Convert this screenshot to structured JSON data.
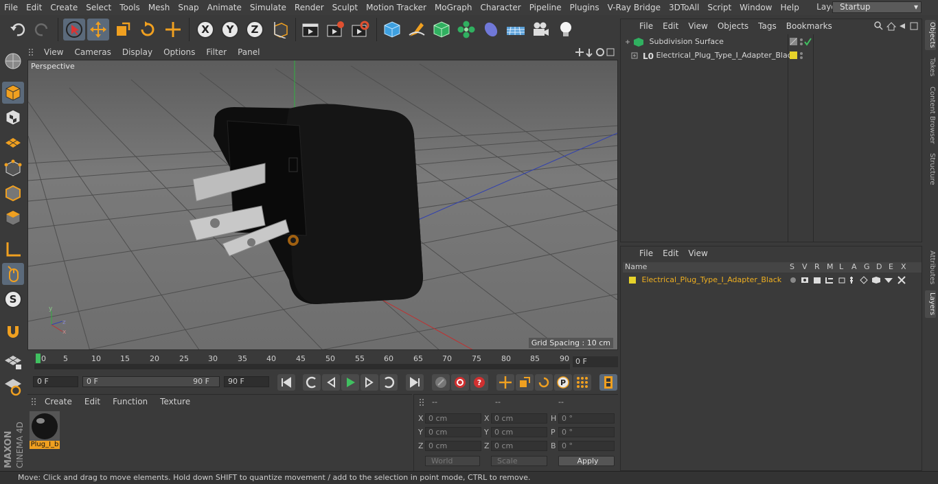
{
  "menubar": {
    "items": [
      "File",
      "Edit",
      "Create",
      "Select",
      "Tools",
      "Mesh",
      "Snap",
      "Animate",
      "Simulate",
      "Render",
      "Sculpt",
      "Motion Tracker",
      "MoGraph",
      "Character",
      "Pipeline",
      "Plugins",
      "V-Ray Bridge",
      "3DToAll",
      "Script",
      "Window",
      "Help"
    ],
    "layout_label": "Layout:",
    "layout_value": "Startup"
  },
  "toolbar": {
    "icons": [
      "undo-icon",
      "redo-icon",
      "select-arrow-icon",
      "move-icon",
      "scale-icon",
      "rotate-icon",
      "transform-icon",
      "x-axis-icon",
      "y-axis-icon",
      "z-axis-icon",
      "world-coord-icon",
      "render-view-icon",
      "render-picture-viewer-icon",
      "render-settings-icon",
      "cube-icon",
      "pen-icon",
      "subdivision-icon",
      "cloner-icon",
      "deformer-icon",
      "floor-icon",
      "camera-icon",
      "light-icon"
    ],
    "axis_x": "X",
    "axis_y": "Y",
    "axis_z": "Z"
  },
  "viewport": {
    "menu": [
      "View",
      "Cameras",
      "Display",
      "Options",
      "Filter",
      "Panel"
    ],
    "label": "Perspective",
    "grid_spacing": "Grid Spacing : 10 cm"
  },
  "timeline": {
    "ticks": [
      "0",
      "5",
      "10",
      "15",
      "20",
      "25",
      "30",
      "35",
      "40",
      "45",
      "50",
      "55",
      "60",
      "65",
      "70",
      "75",
      "80",
      "85",
      "90"
    ],
    "current_frame": "0 F"
  },
  "transport": {
    "start_field": "0 F",
    "range_start": "0 F",
    "range_end": "90 F",
    "end_field": "90 F"
  },
  "materials": {
    "menu": [
      "Create",
      "Edit",
      "Function",
      "Texture"
    ],
    "material_name": "Plug_I_b"
  },
  "coords": {
    "header": [
      "--",
      "--",
      "--"
    ],
    "rows": [
      {
        "a": "X",
        "av": "0 cm",
        "b": "X",
        "bv": "0 cm",
        "c": "H",
        "cv": "0 °"
      },
      {
        "a": "Y",
        "av": "0 cm",
        "b": "Y",
        "bv": "0 cm",
        "c": "P",
        "cv": "0 °"
      },
      {
        "a": "Z",
        "av": "0 cm",
        "b": "Z",
        "bv": "0 cm",
        "c": "B",
        "cv": "0 °"
      }
    ],
    "world": "World",
    "scale": "Scale",
    "apply": "Apply"
  },
  "objects": {
    "menu": [
      "File",
      "Edit",
      "View",
      "Objects",
      "Tags",
      "Bookmarks"
    ],
    "items": [
      "Subdivision Surface",
      "Electrical_Plug_Type_I_Adapter_Black"
    ]
  },
  "layers": {
    "menu": [
      "File",
      "Edit",
      "View"
    ],
    "columns": [
      "Name",
      "S",
      "V",
      "R",
      "M",
      "L",
      "A",
      "G",
      "D",
      "E",
      "X"
    ],
    "item": "Electrical_Plug_Type_I_Adapter_Black",
    "layer_color": "#e6d22a"
  },
  "right_tabs": [
    "Objects",
    "Takes",
    "Content Browser",
    "Structure",
    "Attributes",
    "Layers"
  ],
  "status": "Move: Click and drag to move elements. Hold down SHIFT to quantize movement / add to the selection in point mode, CTRL to remove.",
  "brand": {
    "maxon": "MAXON",
    "product": "CINEMA 4D"
  }
}
